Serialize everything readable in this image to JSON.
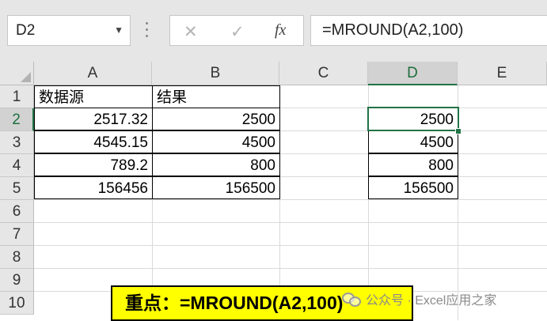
{
  "formula_bar": {
    "name_box": "D2",
    "cancel_glyph": "✕",
    "enter_glyph": "✓",
    "fx_label": "fx",
    "formula": "=MROUND(A2,100)"
  },
  "columns": [
    "A",
    "B",
    "C",
    "D",
    "E"
  ],
  "rows": [
    "1",
    "2",
    "3",
    "4",
    "5",
    "6",
    "7",
    "8",
    "9",
    "10"
  ],
  "selected_cell": {
    "column": "D",
    "row": "2"
  },
  "table": {
    "headers": [
      "数据源",
      "结果"
    ],
    "data": [
      [
        "2517.32",
        "2500"
      ],
      [
        "4545.15",
        "4500"
      ],
      [
        "789.2",
        "800"
      ],
      [
        "156456",
        "156500"
      ]
    ]
  },
  "column_d_values": [
    "2500",
    "4500",
    "800",
    "156500"
  ],
  "callout": {
    "text": "重点：=MROUND(A2,100)"
  },
  "watermark": {
    "text": "公众号 · Excel应用之家"
  },
  "colors": {
    "accent": "#217346",
    "callout_bg": "#ffff00"
  }
}
